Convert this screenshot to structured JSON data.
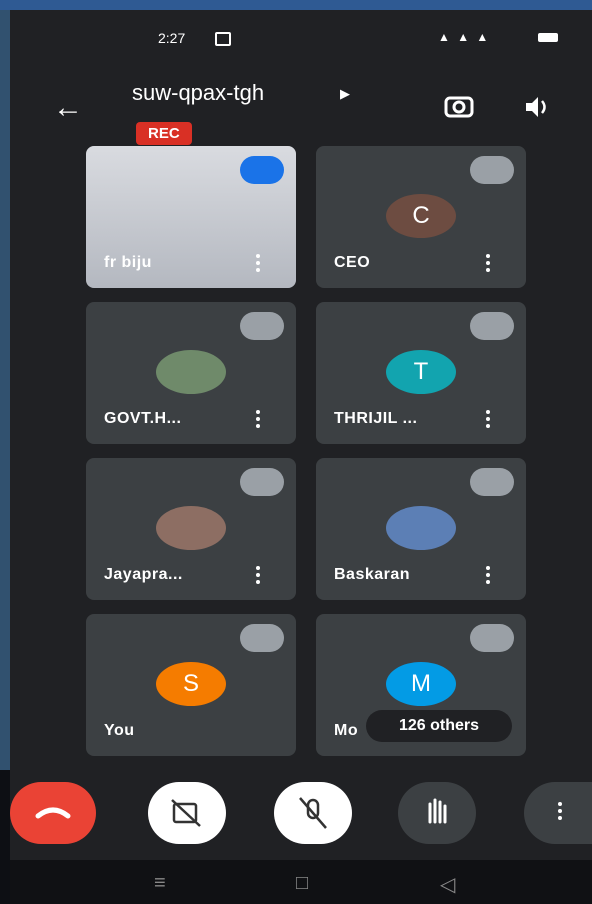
{
  "status": {
    "time": "2:27"
  },
  "header": {
    "meeting_code": "suw-qpax-tgh",
    "rec_label": "REC"
  },
  "tiles": [
    {
      "name": "fr biju",
      "type": "video"
    },
    {
      "name": "CEO",
      "initial": "C",
      "color": "#6d4c41"
    },
    {
      "name": "GOVT.H...",
      "type": "photo"
    },
    {
      "name": "THRIJIL ...",
      "initial": "T",
      "color": "#12a4af"
    },
    {
      "name": "Jayapra...",
      "type": "photo"
    },
    {
      "name": "Baskaran",
      "type": "photo"
    },
    {
      "name": "You",
      "initial": "S",
      "color": "#f57c00"
    },
    {
      "name": "Mo",
      "initial": "M",
      "color": "#039be5",
      "others": "126 others"
    }
  ],
  "icons": {
    "back": "arrow-left",
    "switch": "camera-switch",
    "speaker": "speaker",
    "end": "phone-hangup",
    "camera": "camera-off",
    "mic": "mic-off",
    "hand": "raise-hand",
    "more": "more-vertical"
  }
}
